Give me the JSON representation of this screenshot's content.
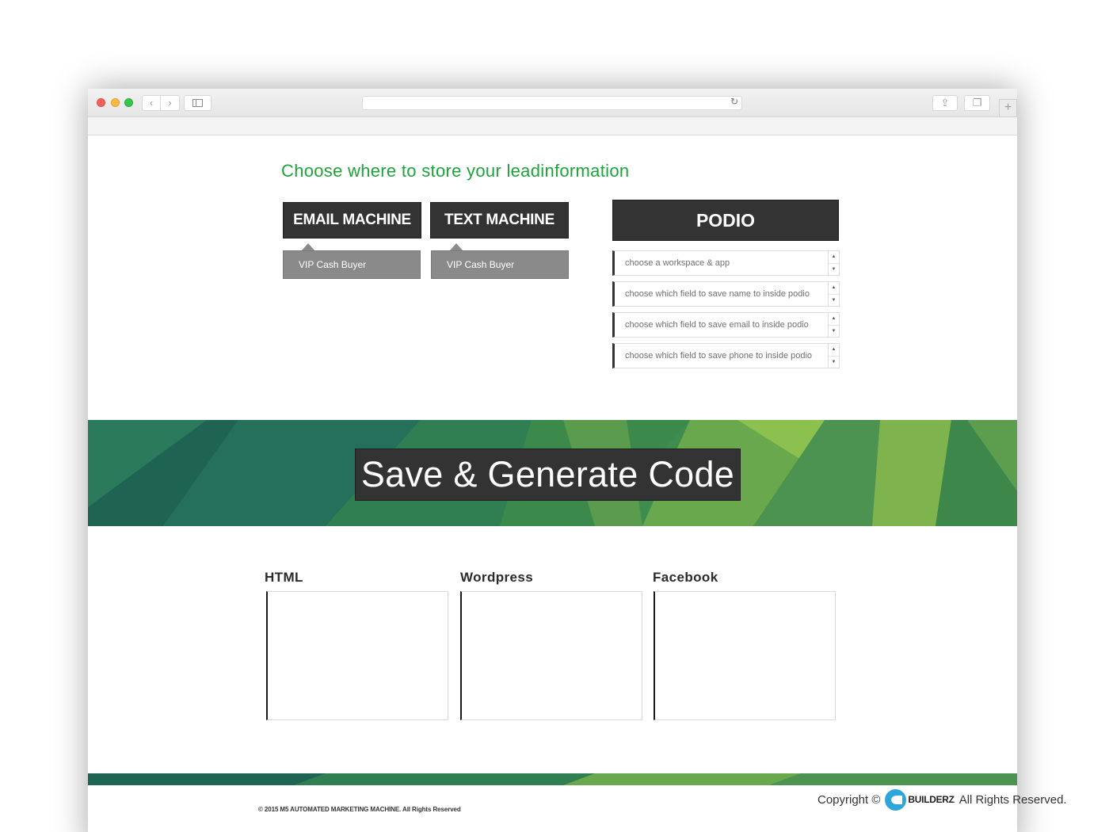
{
  "page": {
    "heading": "Choose where to store your leadinformation"
  },
  "machines": [
    {
      "title": "EMAIL MACHINE",
      "selected": "VIP Cash Buyer"
    },
    {
      "title": "TEXT MACHINE",
      "selected": "VIP Cash  Buyer"
    }
  ],
  "podio": {
    "title": "PODIO",
    "selects": [
      "choose a workspace  & app",
      "choose which field to save name to inside podio",
      "choose which field to save email to inside podio",
      "choose which field to save phone to inside podio"
    ]
  },
  "banner": {
    "button_label": "Save & Generate Code",
    "colors": {
      "dark": "#1f6452",
      "mid": "#3f8d4e",
      "light": "#8cc04f"
    }
  },
  "code": {
    "columns": [
      "HTML",
      "Wordpress",
      "Facebook"
    ]
  },
  "footer": {
    "text": "© 2015 M5 AUTOMATED MARKETING MACHINE. All Rights Reserved"
  },
  "copyright": {
    "prefix": "Copyright ©",
    "brand": "BUILDERZ",
    "suffix": "All Rights Reserved."
  },
  "icons": {
    "back": "chevron-left-icon",
    "forward": "chevron-right-icon",
    "sidebar": "sidebar-icon",
    "reload": "reload-icon",
    "share": "share-icon",
    "tabs": "tabs-icon",
    "new_tab": "plus-icon"
  }
}
